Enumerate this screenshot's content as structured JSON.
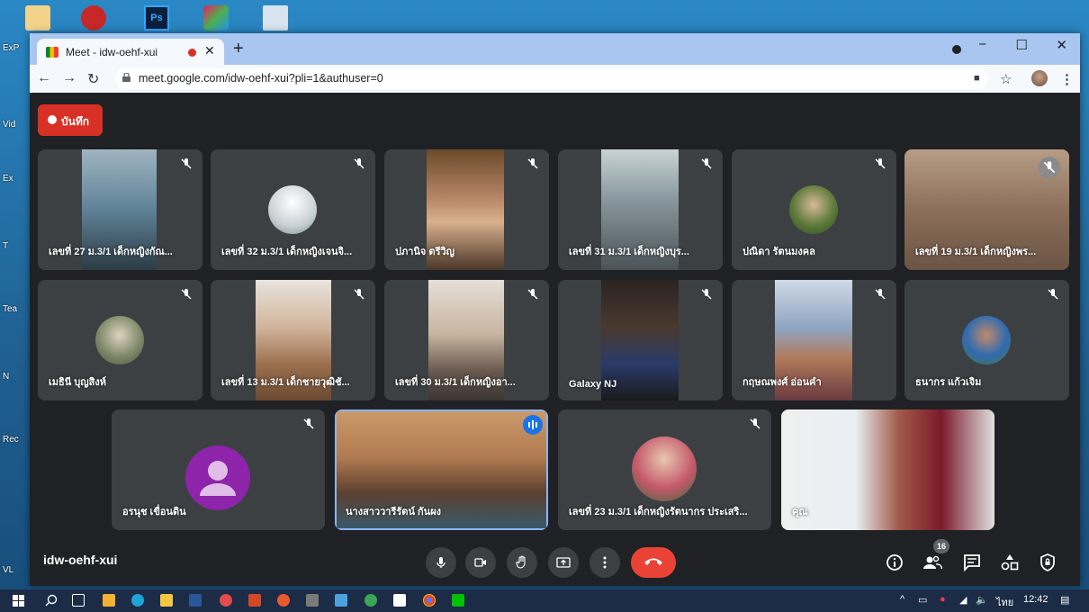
{
  "browser": {
    "tab_title": "Meet - idw-oehf-xui",
    "url": "meet.google.com/idw-oehf-xui?pli=1&authuser=0"
  },
  "meet": {
    "record_label": "บันทึก",
    "meeting_code": "idw-oehf-xui",
    "participant_count": "16",
    "tiles": [
      {
        "name": "เลขที่ 27 ม.3/1 เด็กหญิงกัณ..."
      },
      {
        "name": "เลขที่ 32 ม.3/1 เด็กหญิงเจนจิ..."
      },
      {
        "name": "ปภานิจ ตรีวิญ"
      },
      {
        "name": "เลขที่ 31 ม.3/1 เด็กหญิงบุร..."
      },
      {
        "name": "ปณิดา รัตนมงคล"
      },
      {
        "name": "เลขที่ 19 ม.3/1 เด็กหญิงพร..."
      },
      {
        "name": "เมธินี บุญสิงห์"
      },
      {
        "name": "เลขที่ 13 ม.3/1 เด็กชายวุฒิชั..."
      },
      {
        "name": "เลขที่ 30 ม.3/1 เด็กหญิงอา..."
      },
      {
        "name": "Galaxy NJ"
      },
      {
        "name": "กฤษณพงศ์ อ่อนคำ"
      },
      {
        "name": "ธนากร แก้วเจิม"
      },
      {
        "name": "อรนุช เขื่อนดิน"
      },
      {
        "name": "นางสาววารีรัตน์ กันผง"
      },
      {
        "name": "เลขที่ 23 ม.3/1 เด็กหญิงรัตนากร ประเสริ..."
      },
      {
        "name": "คุณ"
      }
    ]
  },
  "taskbar": {
    "time": "12:42",
    "language": "ไทย"
  },
  "desktop": {
    "icon_labels": [
      "ExP",
      "Vid",
      "Ex",
      "T",
      "Tea",
      "N",
      "Rec",
      "VL"
    ]
  }
}
